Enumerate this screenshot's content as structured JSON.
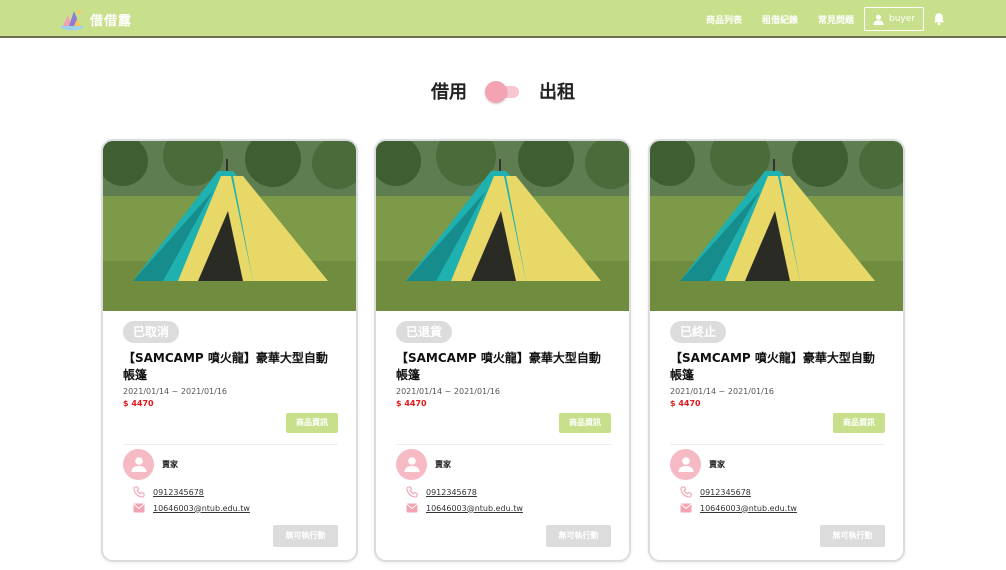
{
  "header": {
    "brand": "借借露",
    "nav": [
      "商品列表",
      "租借紀錄",
      "常見問題"
    ],
    "user_label": "buyer"
  },
  "toggle": {
    "left_label": "借用",
    "right_label": "出租"
  },
  "cards": [
    {
      "status": "已取消",
      "title": "【SAMCAMP 噴火龍】豪華大型自動帳篷",
      "date_range": "2021/01/14 ~ 2021/01/16",
      "price": "$ 4470",
      "info_button": "商品資訊",
      "seller_label": "賣家",
      "phone": "0912345678",
      "email": "10646003@ntub.edu.tw",
      "action_button": "無可執行動作"
    },
    {
      "status": "已退貨",
      "title": "【SAMCAMP 噴火龍】豪華大型自動帳篷",
      "date_range": "2021/01/14 ~ 2021/01/16",
      "price": "$ 4470",
      "info_button": "商品資訊",
      "seller_label": "賣家",
      "phone": "0912345678",
      "email": "10646003@ntub.edu.tw",
      "action_button": "無可執行動作"
    },
    {
      "status": "已終止",
      "title": "【SAMCAMP 噴火龍】豪華大型自動帳篷",
      "date_range": "2021/01/14 ~ 2021/01/16",
      "price": "$ 4470",
      "info_button": "商品資訊",
      "seller_label": "賣家",
      "phone": "0912345678",
      "email": "10646003@ntub.edu.tw",
      "action_button": "無可執行動作"
    }
  ],
  "colors": {
    "navbar": "#c8e08c",
    "accent_pink": "#f4a3b2",
    "badge_gray": "#dcdcdc",
    "price_red": "#e0191f"
  },
  "icons": [
    "user-icon",
    "bell-icon",
    "phone-icon",
    "mail-icon",
    "avatar-icon",
    "logo-icon"
  ]
}
